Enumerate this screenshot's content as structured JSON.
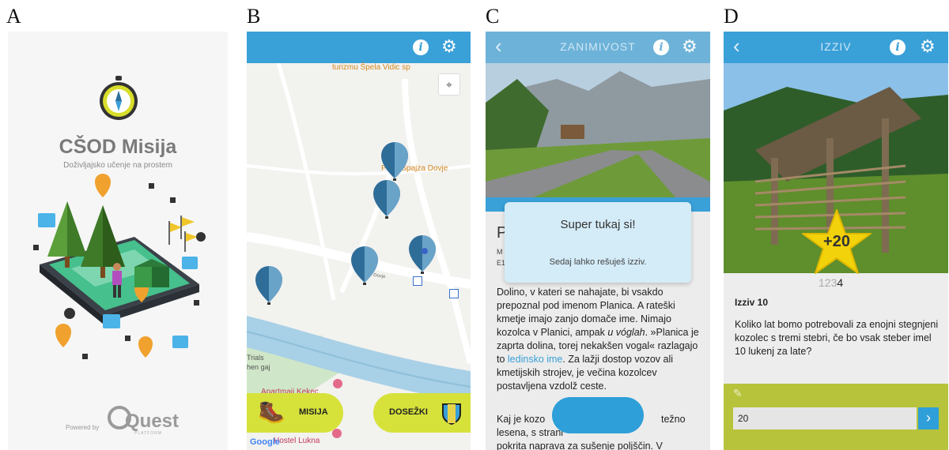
{
  "panels": {
    "a": {
      "label": "A"
    },
    "b": {
      "label": "B"
    },
    "c": {
      "label": "C"
    },
    "d": {
      "label": "D"
    }
  },
  "splash": {
    "app_title": "CŠOD Misija",
    "subtitle": "Doživljajsko učenje na prostem",
    "powered_by": "Powered by",
    "brand": "Quest",
    "brand_sub": "PLATFORM"
  },
  "map": {
    "labels": {
      "turizmu": "turizmu Špela Vidic sp",
      "pizzeria": "P  rija Špajza Dovje",
      "dovje": "Dovje",
      "trials": "Trials",
      "gaj": "hen gaj",
      "apartmaji": "Apartmaji Kekec",
      "hostel": "Hostel Lukna",
      "google": "Google"
    },
    "buttons": {
      "misija": "MISIJA",
      "dosezki": "DOSEŽKI"
    }
  },
  "detail": {
    "title": "ZANIMIVOST",
    "heading_fragment": "P",
    "meta_fragment_1": "M",
    "meta_fragment_2": "E1",
    "body": "Dolino, v kateri se nahajate, bi vsakdo prepoznal pod imenom Planica. A rateški kmetje imajo zanjo domače ime. Nimajo kozolca v Planici, ampak ",
    "body_italic": "u vóglah",
    "body_2": ". »Planica je zaprta dolina, torej nekakšen vogal« razlagajo to ",
    "body_link": "ledinsko ime",
    "body_3": ". Za lažji dostop vozov ali kmetijskih strojev, je večina kozolcev postavljena vzdolž ceste.",
    "body_4_a": "Kaj je kozo",
    "body_4_b": "težno",
    "body_4_c": "lesena, s strani",
    "body_4_d": "pokrita naprava za sušenje poljščin. V",
    "modal": {
      "title": "Super tukaj si!",
      "text": "Sedaj lahko rešuješ izziv."
    }
  },
  "challenge": {
    "title": "IZZIV",
    "star_points": "+20",
    "pager": [
      "1",
      "2",
      "3",
      "4"
    ],
    "active_page": "4",
    "heading": "Izziv 10",
    "question": "Koliko lat bomo potrebovali za enojni stegnjeni kozolec s tremi stebri, če bo vsak steber imel 10 lukenj za late?",
    "answer_value": "20"
  },
  "colors": {
    "topbar": "#3aa0d8",
    "map_accent": "#d6e23a",
    "pin_blue": "#2f6d99",
    "star": "#f2d20a"
  }
}
